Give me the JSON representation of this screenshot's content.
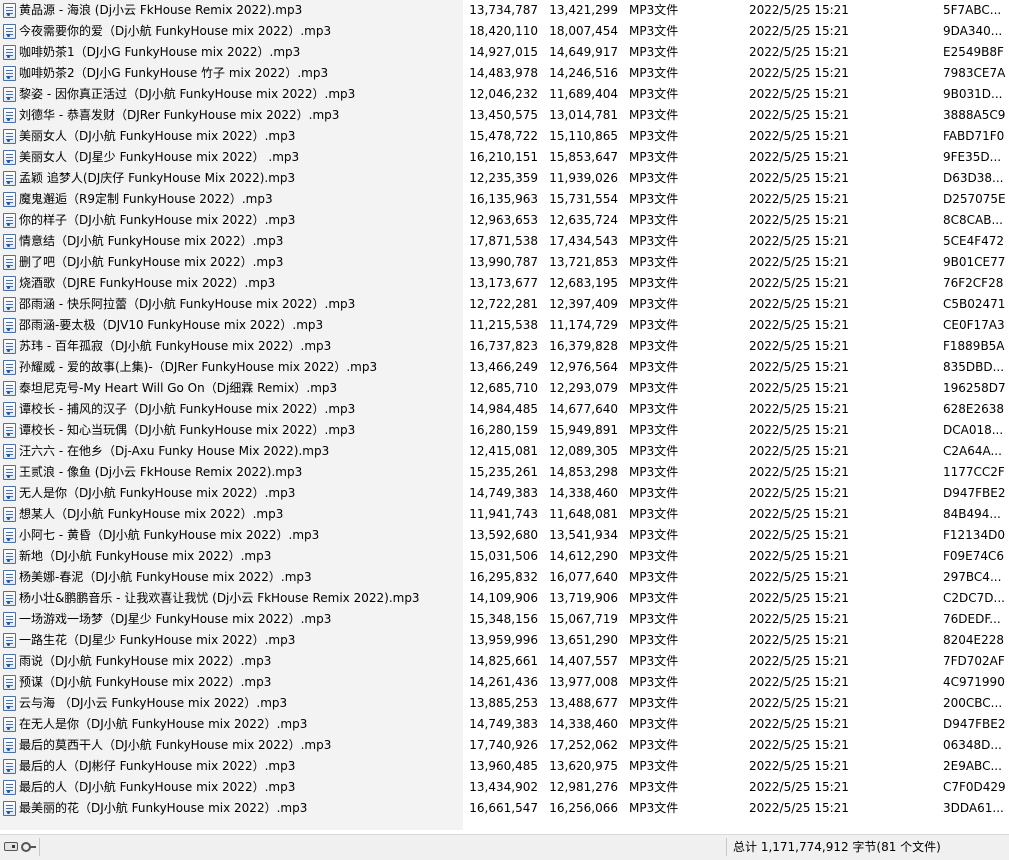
{
  "files": [
    {
      "name": "黄品源 - 海浪 (Dj小云 FkHouse Remix 2022).mp3",
      "size": "13,734,787",
      "packed": "13,421,299",
      "type": "MP3文件",
      "modified": "2022/5/25 15:21",
      "crc": "5F7ABC..."
    },
    {
      "name": "今夜需要你的爱（Dj小航 FunkyHouse mix 2022）.mp3",
      "size": "18,420,110",
      "packed": "18,007,454",
      "type": "MP3文件",
      "modified": "2022/5/25 15:21",
      "crc": "9DA340..."
    },
    {
      "name": "咖啡奶茶1（DJ小G FunkyHouse mix 2022）.mp3",
      "size": "14,927,015",
      "packed": "14,649,917",
      "type": "MP3文件",
      "modified": "2022/5/25 15:21",
      "crc": "E2549B8F"
    },
    {
      "name": "咖啡奶茶2（DJ小G FunkyHouse 竹子 mix 2022）.mp3",
      "size": "14,483,978",
      "packed": "14,246,516",
      "type": "MP3文件",
      "modified": "2022/5/25 15:21",
      "crc": "7983CE7A"
    },
    {
      "name": "黎姿 - 因你真正活过（DJ小航 FunkyHouse mix 2022）.mp3",
      "size": "12,046,232",
      "packed": "11,689,404",
      "type": "MP3文件",
      "modified": "2022/5/25 15:21",
      "crc": "9B031D..."
    },
    {
      "name": "刘德华 - 恭喜发财（DJRer FunkyHouse mix 2022）.mp3",
      "size": "13,450,575",
      "packed": "13,014,781",
      "type": "MP3文件",
      "modified": "2022/5/25 15:21",
      "crc": "3888A5C9"
    },
    {
      "name": "美丽女人（DJ小航 FunkyHouse mix 2022）.mp3",
      "size": "15,478,722",
      "packed": "15,110,865",
      "type": "MP3文件",
      "modified": "2022/5/25 15:21",
      "crc": "FABD71F0"
    },
    {
      "name": "美丽女人（DJ星少 FunkyHouse mix 2022） .mp3",
      "size": "16,210,151",
      "packed": "15,853,647",
      "type": "MP3文件",
      "modified": "2022/5/25 15:21",
      "crc": "9FE35D..."
    },
    {
      "name": "孟颖 追梦人(DJ庆仔 FunkyHouse Mix 2022).mp3",
      "size": "12,235,359",
      "packed": "11,939,026",
      "type": "MP3文件",
      "modified": "2022/5/25 15:21",
      "crc": "D63D38..."
    },
    {
      "name": "魔鬼邂逅（R9定制 FunkyHouse 2022）.mp3",
      "size": "16,135,963",
      "packed": "15,731,554",
      "type": "MP3文件",
      "modified": "2022/5/25 15:21",
      "crc": "D257075E"
    },
    {
      "name": "你的样子（DJ小航 FunkyHouse mix 2022）.mp3",
      "size": "12,963,653",
      "packed": "12,635,724",
      "type": "MP3文件",
      "modified": "2022/5/25 15:21",
      "crc": "8C8CAB..."
    },
    {
      "name": "情意结（DJ小航 FunkyHouse mix 2022）.mp3",
      "size": "17,871,538",
      "packed": "17,434,543",
      "type": "MP3文件",
      "modified": "2022/5/25 15:21",
      "crc": "5CE4F472"
    },
    {
      "name": "删了吧（DJ小航 FunkyHouse mix 2022）.mp3",
      "size": "13,990,787",
      "packed": "13,721,853",
      "type": "MP3文件",
      "modified": "2022/5/25 15:21",
      "crc": "9B01CE77"
    },
    {
      "name": "烧酒歌（DJRE FunkyHouse mix 2022）.mp3",
      "size": "13,173,677",
      "packed": "12,683,195",
      "type": "MP3文件",
      "modified": "2022/5/25 15:21",
      "crc": "76F2CF28"
    },
    {
      "name": "邵雨涵 - 快乐阿拉蕾（DJ小航 FunkyHouse mix 2022）.mp3",
      "size": "12,722,281",
      "packed": "12,397,409",
      "type": "MP3文件",
      "modified": "2022/5/25 15:21",
      "crc": "C5B02471"
    },
    {
      "name": "邵雨涵-要太极（DJV10 FunkyHouse mix 2022）.mp3",
      "size": "11,215,538",
      "packed": "11,174,729",
      "type": "MP3文件",
      "modified": "2022/5/25 15:21",
      "crc": "CE0F17A3"
    },
    {
      "name": "苏玮 - 百年孤寂（DJ小航 FunkyHouse mix 2022）.mp3",
      "size": "16,737,823",
      "packed": "16,379,828",
      "type": "MP3文件",
      "modified": "2022/5/25 15:21",
      "crc": "F1889B5A"
    },
    {
      "name": "孙耀威 - 爱的故事(上集)-（DJRer FunkyHouse mix 2022）.mp3",
      "size": "13,466,249",
      "packed": "12,976,564",
      "type": "MP3文件",
      "modified": "2022/5/25 15:21",
      "crc": "835DBD..."
    },
    {
      "name": "泰坦尼克号-My Heart Will Go On（Dj细霖 Remix）.mp3",
      "size": "12,685,710",
      "packed": "12,293,079",
      "type": "MP3文件",
      "modified": "2022/5/25 15:21",
      "crc": "196258D7"
    },
    {
      "name": "谭校长 - 捕风的汉子（DJ小航 FunkyHouse mix 2022）.mp3",
      "size": "14,984,485",
      "packed": "14,677,640",
      "type": "MP3文件",
      "modified": "2022/5/25 15:21",
      "crc": "628E2638"
    },
    {
      "name": "谭校长 - 知心当玩偶（DJ小航 FunkyHouse mix 2022）.mp3",
      "size": "16,280,159",
      "packed": "15,949,891",
      "type": "MP3文件",
      "modified": "2022/5/25 15:21",
      "crc": "DCA018..."
    },
    {
      "name": "汪六六 - 在他乡（Dj-Axu Funky House Mix 2022).mp3",
      "size": "12,415,081",
      "packed": "12,089,305",
      "type": "MP3文件",
      "modified": "2022/5/25 15:21",
      "crc": "C2A64A..."
    },
    {
      "name": "王贰浪 - 像鱼 (Dj小云 FkHouse Remix 2022).mp3",
      "size": "15,235,261",
      "packed": "14,853,298",
      "type": "MP3文件",
      "modified": "2022/5/25 15:21",
      "crc": "1177CC2F"
    },
    {
      "name": "无人是你（DJ小航 FunkyHouse mix 2022）.mp3",
      "size": "14,749,383",
      "packed": "14,338,460",
      "type": "MP3文件",
      "modified": "2022/5/25 15:21",
      "crc": "D947FBE2"
    },
    {
      "name": "想某人（DJ小航 FunkyHouse mix 2022）.mp3",
      "size": "11,941,743",
      "packed": "11,648,081",
      "type": "MP3文件",
      "modified": "2022/5/25 15:21",
      "crc": "84B494..."
    },
    {
      "name": "小阿七 - 黄昏（DJ小航 FunkyHouse mix 2022）.mp3",
      "size": "13,592,680",
      "packed": "13,541,934",
      "type": "MP3文件",
      "modified": "2022/5/25 15:21",
      "crc": "F12134D0"
    },
    {
      "name": "新地（DJ小航 FunkyHouse mix 2022）.mp3",
      "size": "15,031,506",
      "packed": "14,612,290",
      "type": "MP3文件",
      "modified": "2022/5/25 15:21",
      "crc": "F09E74C6"
    },
    {
      "name": "杨美娜-春泥（DJ小航 FunkyHouse mix 2022）.mp3",
      "size": "16,295,832",
      "packed": "16,077,640",
      "type": "MP3文件",
      "modified": "2022/5/25 15:21",
      "crc": "297BC4..."
    },
    {
      "name": "杨小壮&鹏鹏音乐 - 让我欢喜让我忧 (Dj小云 FkHouse Remix 2022).mp3",
      "size": "14,109,906",
      "packed": "13,719,906",
      "type": "MP3文件",
      "modified": "2022/5/25 15:21",
      "crc": "C2DC7D..."
    },
    {
      "name": "一场游戏一场梦（DJ星少 FunkyHouse mix 2022）.mp3",
      "size": "15,348,156",
      "packed": "15,067,719",
      "type": "MP3文件",
      "modified": "2022/5/25 15:21",
      "crc": "76DEDF..."
    },
    {
      "name": "一路生花（DJ星少 FunkyHouse mix 2022）.mp3",
      "size": "13,959,996",
      "packed": "13,651,290",
      "type": "MP3文件",
      "modified": "2022/5/25 15:21",
      "crc": "8204E228"
    },
    {
      "name": "雨说（DJ小航 FunkyHouse mix 2022）.mp3",
      "size": "14,825,661",
      "packed": "14,407,557",
      "type": "MP3文件",
      "modified": "2022/5/25 15:21",
      "crc": "7FD702AF"
    },
    {
      "name": "预谋（DJ小航 FunkyHouse mix 2022）.mp3",
      "size": "14,261,436",
      "packed": "13,977,008",
      "type": "MP3文件",
      "modified": "2022/5/25 15:21",
      "crc": "4C971990"
    },
    {
      "name": "云与海 （DJ小云 FunkyHouse mix 2022）.mp3",
      "size": "13,885,253",
      "packed": "13,488,677",
      "type": "MP3文件",
      "modified": "2022/5/25 15:21",
      "crc": "200CBC..."
    },
    {
      "name": "在无人是你（DJ小航 FunkyHouse mix 2022）.mp3",
      "size": "14,749,383",
      "packed": "14,338,460",
      "type": "MP3文件",
      "modified": "2022/5/25 15:21",
      "crc": "D947FBE2"
    },
    {
      "name": "最后的莫西干人（DJ小航 FunkyHouse mix 2022）.mp3",
      "size": "17,740,926",
      "packed": "17,252,062",
      "type": "MP3文件",
      "modified": "2022/5/25 15:21",
      "crc": "06348D..."
    },
    {
      "name": "最后的人（DJ彬仔 FunkyHouse mix 2022）.mp3",
      "size": "13,960,485",
      "packed": "13,620,975",
      "type": "MP3文件",
      "modified": "2022/5/25 15:21",
      "crc": "2E9ABC..."
    },
    {
      "name": "最后的人（DJ小航 FunkyHouse mix 2022）.mp3",
      "size": "13,434,902",
      "packed": "12,981,276",
      "type": "MP3文件",
      "modified": "2022/5/25 15:21",
      "crc": "C7F0D429"
    },
    {
      "name": "最美丽的花（DJ小航 FunkyHouse mix 2022）.mp3",
      "size": "16,661,547",
      "packed": "16,256,066",
      "type": "MP3文件",
      "modified": "2022/5/25 15:21",
      "crc": "3DDA61..."
    }
  ],
  "icons": {
    "file": "mp3-file-icon",
    "drive": "drive-icon",
    "key": "key-icon"
  },
  "status": {
    "total": "总计 1,171,774,912 字节(81 个文件)"
  },
  "colors": {
    "name_column_band": "#f3f3f3",
    "statusbar": "#f0f0f0",
    "icon_stroke": "#4a6fa5"
  }
}
